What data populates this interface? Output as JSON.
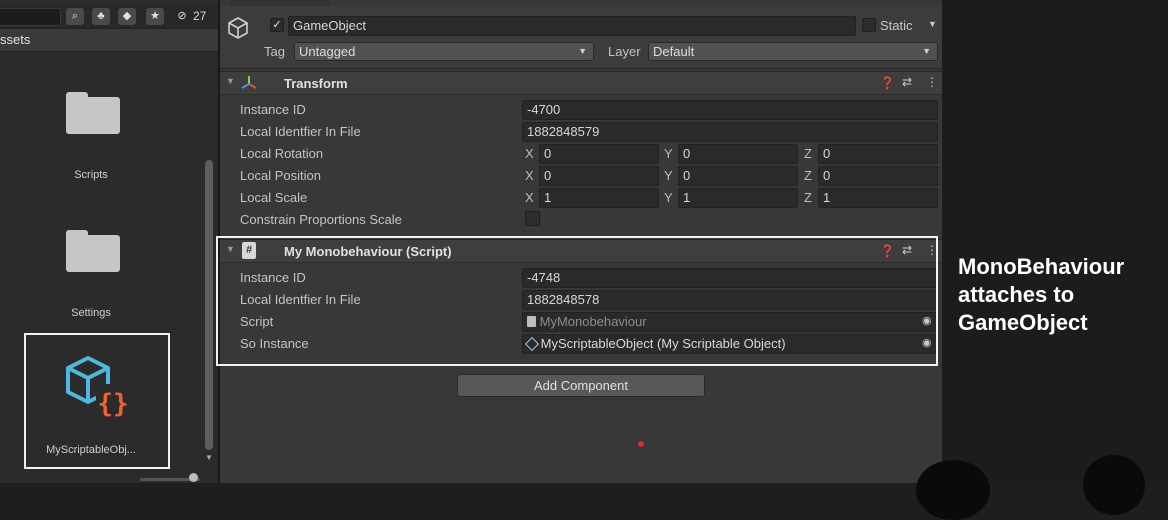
{
  "project": {
    "hidden_count": "27",
    "assets_label": "ssets",
    "items": [
      {
        "label": "Scripts"
      },
      {
        "label": "Settings"
      },
      {
        "label": "MyScriptableObj..."
      }
    ]
  },
  "inspector": {
    "gameobject": {
      "name": "GameObject",
      "static_label": "Static",
      "tag_label": "Tag",
      "tag_value": "Untagged",
      "layer_label": "Layer",
      "layer_value": "Default"
    },
    "transform": {
      "title": "Transform",
      "rows": [
        {
          "label": "Instance ID",
          "value": "-4700"
        },
        {
          "label": "Local Identfier In File",
          "value": "1882848579"
        },
        {
          "label": "Local Rotation",
          "x": "0",
          "y": "0",
          "z": "0"
        },
        {
          "label": "Local Position",
          "x": "0",
          "y": "0",
          "z": "0"
        },
        {
          "label": "Local Scale",
          "x": "1",
          "y": "1",
          "z": "1"
        },
        {
          "label": "Constrain Proportions Scale"
        }
      ]
    },
    "script_component": {
      "title": "My Monobehaviour (Script)",
      "rows": [
        {
          "label": "Instance ID",
          "value": "-4748"
        },
        {
          "label": "Local Identfier In File",
          "value": "1882848578"
        },
        {
          "label": "Script",
          "value": "MyMonobehaviour"
        },
        {
          "label": "So Instance",
          "value": "MyScriptableObject (My Scriptable Object)"
        }
      ]
    },
    "add_component_label": "Add Component"
  },
  "axis_labels": {
    "x": "X",
    "y": "Y",
    "z": "Z"
  },
  "annotation": {
    "lines": [
      "MonoBehaviour",
      "attaches to",
      "GameObject"
    ]
  },
  "colors": {
    "highlight_border": "#f2f2f2",
    "cursor_dot": "#e22a2a",
    "script_icon_cyan": "#4fb8e0",
    "script_icon_orange": "#f0642a"
  }
}
